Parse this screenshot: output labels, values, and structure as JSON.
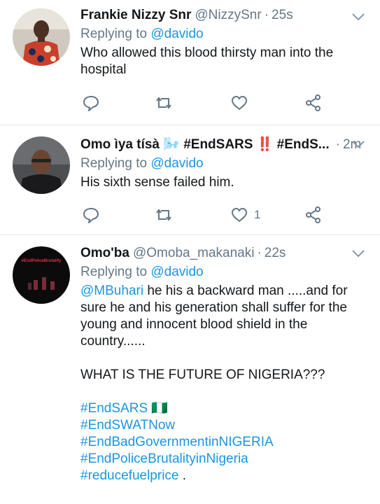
{
  "tweets": [
    {
      "name": "Frankie Nizzy Snr",
      "handle": "@NizzySnr",
      "time": "25s",
      "replying_prefix": "Replying to",
      "replying_to": "@davido",
      "text_lines": [
        "Who allowed this blood thirsty man into the",
        "hospital"
      ],
      "like_count": ""
    },
    {
      "name": "Omo ìya tísà 🌬️ #EndSARS ‼️ #EndS...",
      "handle": "",
      "time": "2m",
      "replying_prefix": "Replying to",
      "replying_to": "@davido",
      "text_lines": [
        "His sixth sense failed him."
      ],
      "like_count": "1"
    },
    {
      "name": "Omo'ba",
      "handle": "@Omoba_makanaki",
      "time": "22s",
      "replying_prefix": "Replying to",
      "replying_to": "@davido",
      "mention": "@MBuhari",
      "text_lines": [
        " he his a backward man .....and for",
        "sure he and his generation shall suffer for the",
        "young and innocent blood shield in the",
        "country......",
        "",
        "WHAT IS THE FUTURE OF NIGERIA???",
        ""
      ],
      "hashtags": [
        "#EndSARS",
        "#EndSWATNow",
        "#EndBadGovernmentinNIGERIA",
        "#EndPoliceBrutalityinNigeria",
        "#reducefuelprice"
      ],
      "hashtag_suffix_1": " 🇳🇬",
      "hashtag_suffix_5": " .",
      "avatar_text": "#EndPoliceBrutality"
    }
  ],
  "colors": {
    "link": "#1b95e0",
    "muted": "#657786",
    "text": "#14171a",
    "divider": "#e1e8ed"
  }
}
